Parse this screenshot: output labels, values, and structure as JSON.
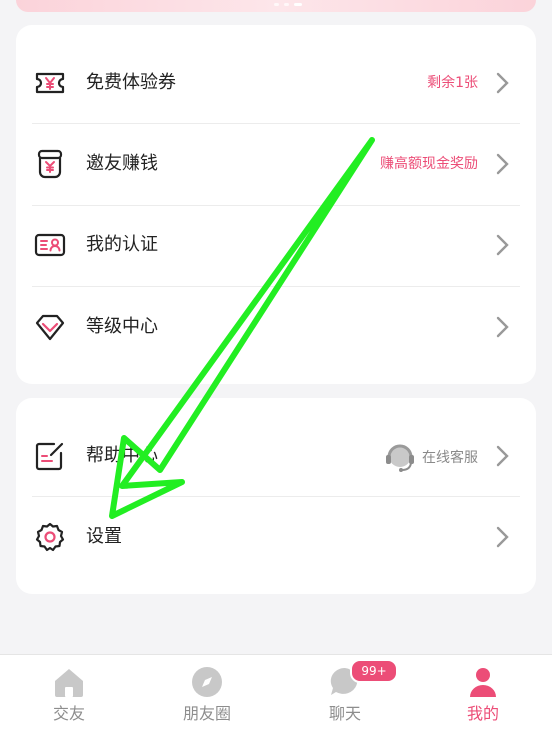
{
  "menu_card_1": {
    "items": [
      {
        "label": "免费体验券",
        "right": "剩余1张",
        "icon": "coupon-yen-icon"
      },
      {
        "label": "邀友赚钱",
        "right": "赚高额现金奖励",
        "icon": "jar-yen-icon"
      },
      {
        "label": "我的认证",
        "right": "",
        "icon": "id-card-icon"
      },
      {
        "label": "等级中心",
        "right": "",
        "icon": "diamond-icon"
      }
    ]
  },
  "menu_card_2": {
    "items": [
      {
        "label": "帮助中心",
        "right": "在线客服",
        "icon": "edit-note-icon",
        "right_icon": "headset-icon"
      },
      {
        "label": "设置",
        "right": "",
        "icon": "gear-icon"
      }
    ]
  },
  "tabbar": {
    "tabs": [
      {
        "label": "交友",
        "icon": "home-icon",
        "active": false
      },
      {
        "label": "朋友圈",
        "icon": "compass-icon",
        "active": false
      },
      {
        "label": "聊天",
        "icon": "chat-icon",
        "active": false,
        "badge": "99+"
      },
      {
        "label": "我的",
        "icon": "person-icon",
        "active": true
      }
    ]
  },
  "colors": {
    "accent": "#ec4d77",
    "annotation_arrow": "#22ee22"
  }
}
